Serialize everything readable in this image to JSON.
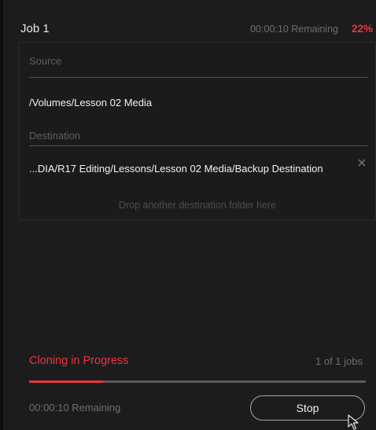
{
  "job": {
    "title": "Job 1",
    "remaining": "00:00:10 Remaining",
    "percent": "22%"
  },
  "card": {
    "source_label": "Source",
    "source_path": "/Volumes/Lesson 02 Media",
    "destination_label": "Destination",
    "destination_path": "...DIA/R17 Editing/Lessons/Lesson 02 Media/Backup Destination",
    "remove_icon": "close-icon",
    "drop_hint": "Drop another destination folder here"
  },
  "footer": {
    "status": "Cloning in Progress",
    "job_count": "1 of 1 jobs",
    "progress_fraction": 0.22,
    "remaining": "00:00:10 Remaining",
    "stop_label": "Stop"
  },
  "colors": {
    "accent_red": "#e8363c",
    "panel_bg": "#1c1c1e",
    "muted_text": "#6e6e70"
  }
}
